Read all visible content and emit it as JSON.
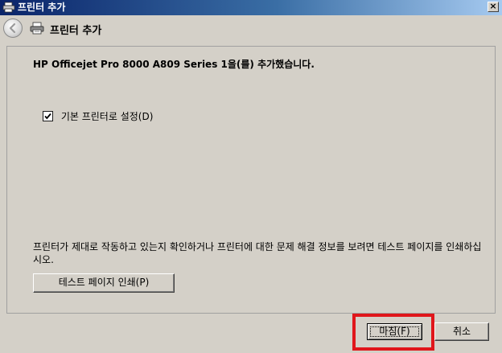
{
  "window": {
    "title": "프린터 추가",
    "close_label": "×"
  },
  "header": {
    "title": "프린터 추가"
  },
  "content": {
    "success_message": "HP Officejet Pro 8000 A809 Series 1을(를) 추가했습니다.",
    "default_printer": {
      "label": "기본 프린터로 설정(D)",
      "checked": true
    },
    "info_text": "프린터가 제대로 작동하고 있는지 확인하거나 프린터에 대한 문제 해결 정보를 보려면 테스트 페이지를 인쇄하십시오.",
    "test_page_button": "테스트 페이지 인쇄(P)"
  },
  "footer": {
    "finish_button": "마침(F)",
    "cancel_button": "취소"
  },
  "colors": {
    "title_bar_start": "#0a246a",
    "title_bar_end": "#a6caf0",
    "dialog_bg": "#d4d0c8",
    "highlight": "#e0161b"
  },
  "icons": {
    "app": "printer-icon",
    "back": "back-arrow-icon",
    "header": "printer-icon",
    "close": "close-icon",
    "checkbox": "checkmark-icon"
  }
}
